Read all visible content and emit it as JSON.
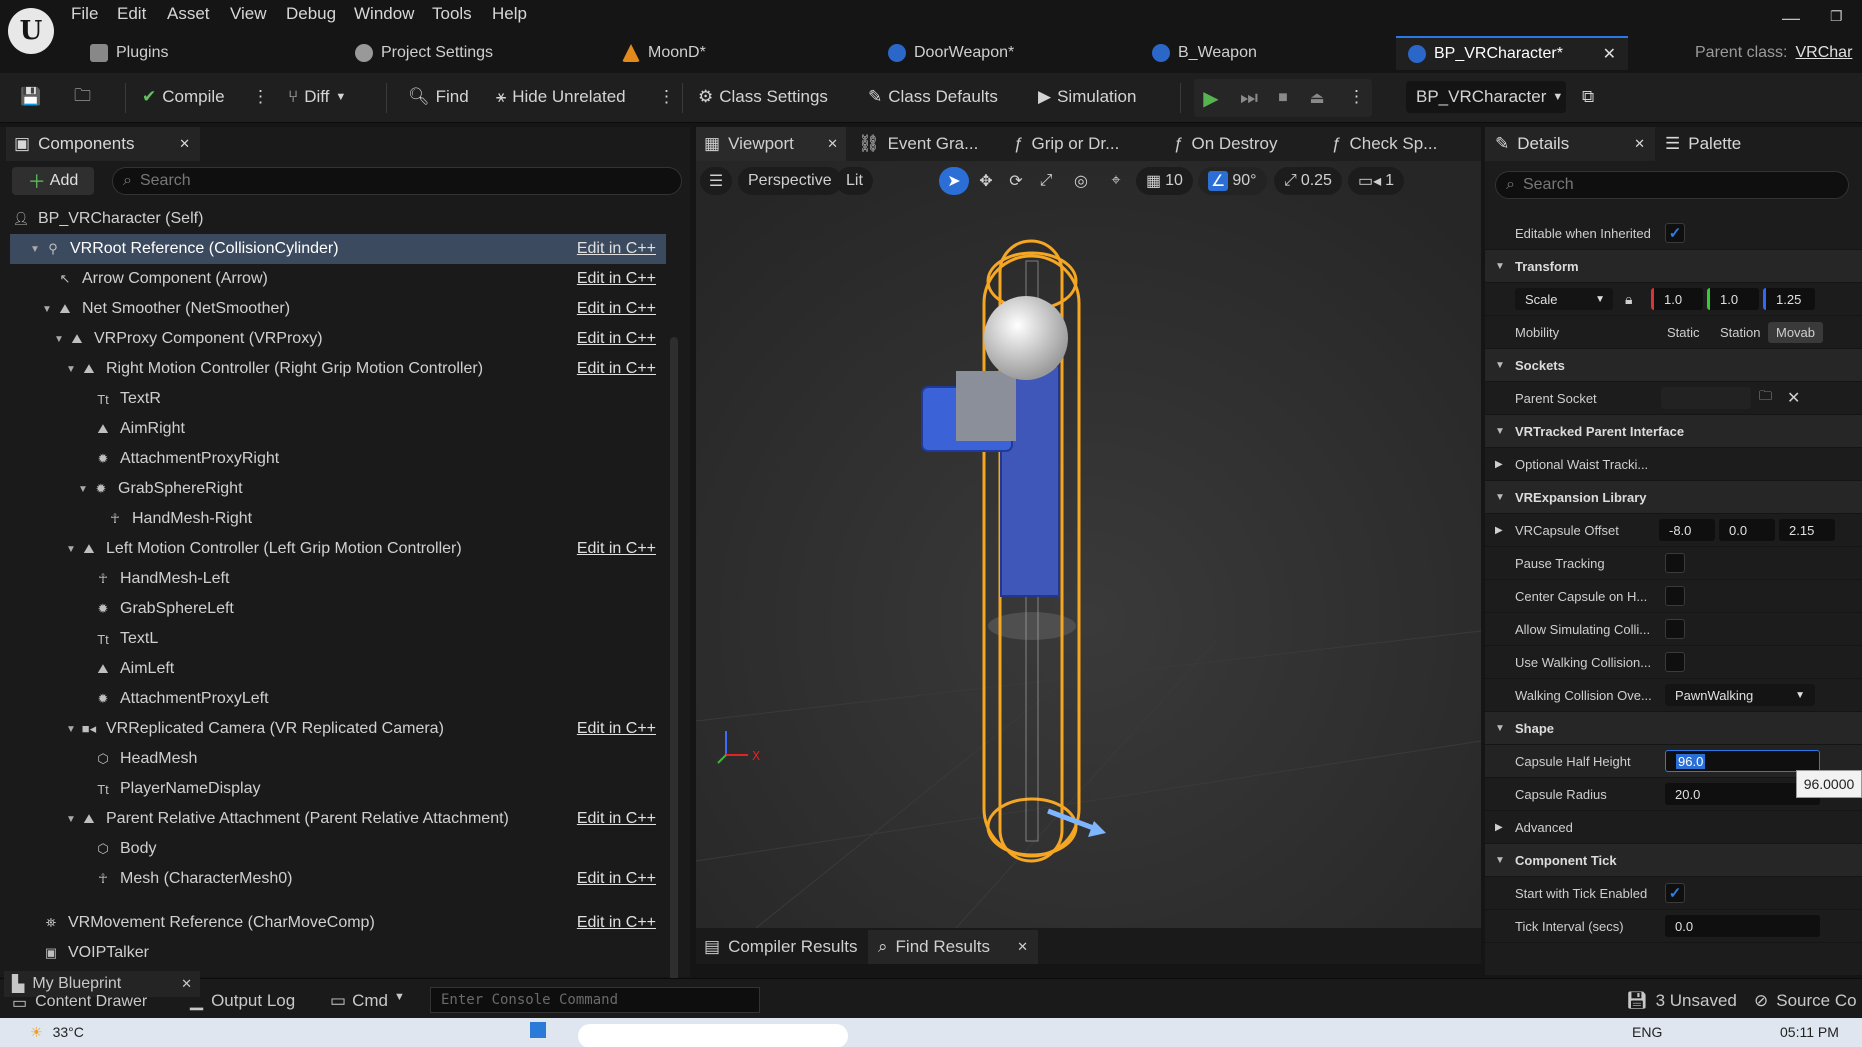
{
  "menu": [
    "File",
    "Edit",
    "Asset",
    "View",
    "Debug",
    "Window",
    "Tools",
    "Help"
  ],
  "tabs": {
    "plugins": "Plugins",
    "project_settings": "Project Settings",
    "moon": "MoonD*",
    "door": "DoorWeapon*",
    "weapon": "B_Weapon",
    "active": "BP_VRCharacter*",
    "parent_class_label": "Parent class:",
    "parent_class_value": "VRChar"
  },
  "toolbar": {
    "compile": "Compile",
    "diff": "Diff",
    "find": "Find",
    "hide_unrelated": "Hide Unrelated",
    "class_settings": "Class Settings",
    "class_defaults": "Class Defaults",
    "simulation": "Simulation",
    "debug_object": "BP_VRCharacter"
  },
  "components": {
    "tab": "Components",
    "add": "Add",
    "search_placeholder": "Search",
    "edit_cpp": "Edit in C++",
    "items": [
      "BP_VRCharacter (Self)",
      "VRRoot Reference (CollisionCylinder)",
      "Arrow Component (Arrow)",
      "Net Smoother (NetSmoother)",
      "VRProxy Component (VRProxy)",
      "Right Motion Controller (Right Grip Motion Controller)",
      "TextR",
      "AimRight",
      "AttachmentProxyRight",
      "GrabSphereRight",
      "HandMesh-Right",
      "Left Motion Controller (Left Grip Motion Controller)",
      "HandMesh-Left",
      "GrabSphereLeft",
      "TextL",
      "AimLeft",
      "AttachmentProxyLeft",
      "VRReplicated Camera (VR Replicated Camera)",
      "HeadMesh",
      "PlayerNameDisplay",
      "Parent Relative Attachment (Parent Relative Attachment)",
      "Body",
      "Mesh (CharacterMesh0)",
      "VRMovement Reference (CharMoveComp)",
      "VOIPTalker"
    ]
  },
  "center": {
    "tabs": [
      "Viewport",
      "Event Gra...",
      "Grip or Dr...",
      "On Destroy",
      "Check Sp..."
    ],
    "perspective": "Perspective",
    "lit": "Lit",
    "grid_size": "10",
    "rot_snap": "90°",
    "scale_snap": "0.25",
    "cam_speed": "1",
    "compiler_results": "Compiler Results",
    "find_results": "Find Results"
  },
  "details": {
    "tab": "Details",
    "palette": "Palette",
    "search_placeholder": "Search",
    "editable_inherited": "Editable when Inherited",
    "transform": "Transform",
    "scale_mode": "Scale",
    "scale": [
      "1.0",
      "1.0",
      "1.25"
    ],
    "mobility": "Mobility",
    "mobility_opts": [
      "Static",
      "Station",
      "Movab"
    ],
    "sockets": "Sockets",
    "parent_socket": "Parent Socket",
    "vrtracked": "VRTracked Parent Interface",
    "optional_waist": "Optional Waist Tracki...",
    "vrexp": "VRExpansion Library",
    "vrcapsule_offset": "VRCapsule Offset",
    "offset": [
      "-8.0",
      "0.0",
      "2.15"
    ],
    "pause_tracking": "Pause Tracking",
    "center_capsule": "Center Capsule on H...",
    "allow_sim": "Allow Simulating Colli...",
    "use_walking": "Use Walking Collision...",
    "walking_override": "Walking Collision Ove...",
    "walking_value": "PawnWalking",
    "shape": "Shape",
    "half_height": "Capsule Half Height",
    "half_height_val": "96.0",
    "tooltip": "96.0000",
    "radius": "Capsule Radius",
    "radius_val": "20.0",
    "advanced": "Advanced",
    "component_tick": "Component Tick",
    "start_tick": "Start with Tick Enabled",
    "tick_interval": "Tick Interval (secs)",
    "tick_interval_val": "0.0"
  },
  "status": {
    "my_blueprint": "My Blueprint",
    "content_drawer": "Content Drawer",
    "output_log": "Output Log",
    "cmd": "Cmd",
    "console_placeholder": "Enter Console Command",
    "unsaved": "3 Unsaved",
    "source_control": "Source Co"
  },
  "taskbar": {
    "temp": "33°C",
    "lang": "ENG",
    "time": "05:11 PM"
  }
}
